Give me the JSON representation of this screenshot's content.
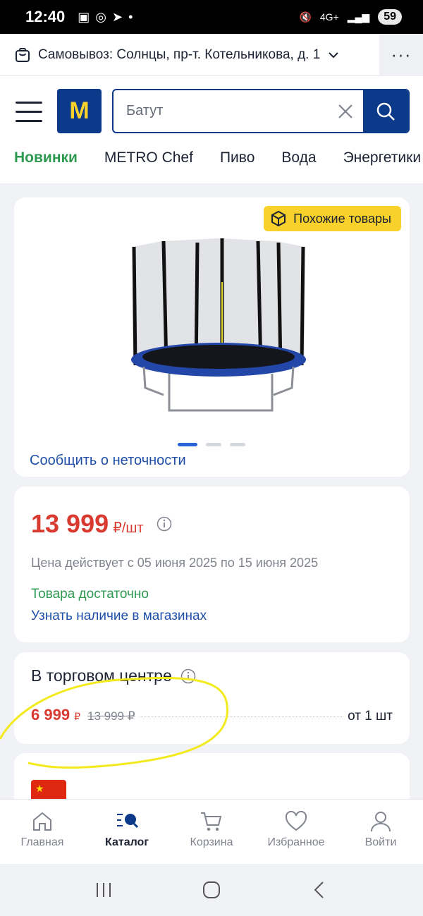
{
  "status": {
    "time": "12:40",
    "network": "4G+",
    "battery": "59"
  },
  "pickup": {
    "label": "Самовывоз: Солнцы, пр-т. Котельникова, д. 1"
  },
  "search": {
    "value": "Батут"
  },
  "logo": {
    "letter": "M"
  },
  "categories": [
    "Новинки",
    "METRO Chef",
    "Пиво",
    "Вода",
    "Энергетики"
  ],
  "product": {
    "similar_label": "Похожие товары",
    "report_label": "Сообщить о неточности",
    "price": "13 999",
    "price_unit": "₽/шт",
    "validity": "Цена действует с 05 июня 2025 по 15 июня 2025",
    "stock": "Товара достаточно",
    "check_stores": "Узнать наличие в магазинах"
  },
  "trade_center": {
    "title": "В торговом центре",
    "price": "6 999",
    "currency": "₽",
    "old_price": "13 999 ₽",
    "quantity": "от 1 шт"
  },
  "tabs": [
    {
      "label": "Главная"
    },
    {
      "label": "Каталог"
    },
    {
      "label": "Корзина"
    },
    {
      "label": "Избранное"
    },
    {
      "label": "Войти"
    }
  ],
  "colors": {
    "brand_blue": "#0c3a8a",
    "brand_yellow": "#f8d12a",
    "price_red": "#d93a30",
    "green": "#2e9a52",
    "highlight": "#f2ea1c"
  }
}
